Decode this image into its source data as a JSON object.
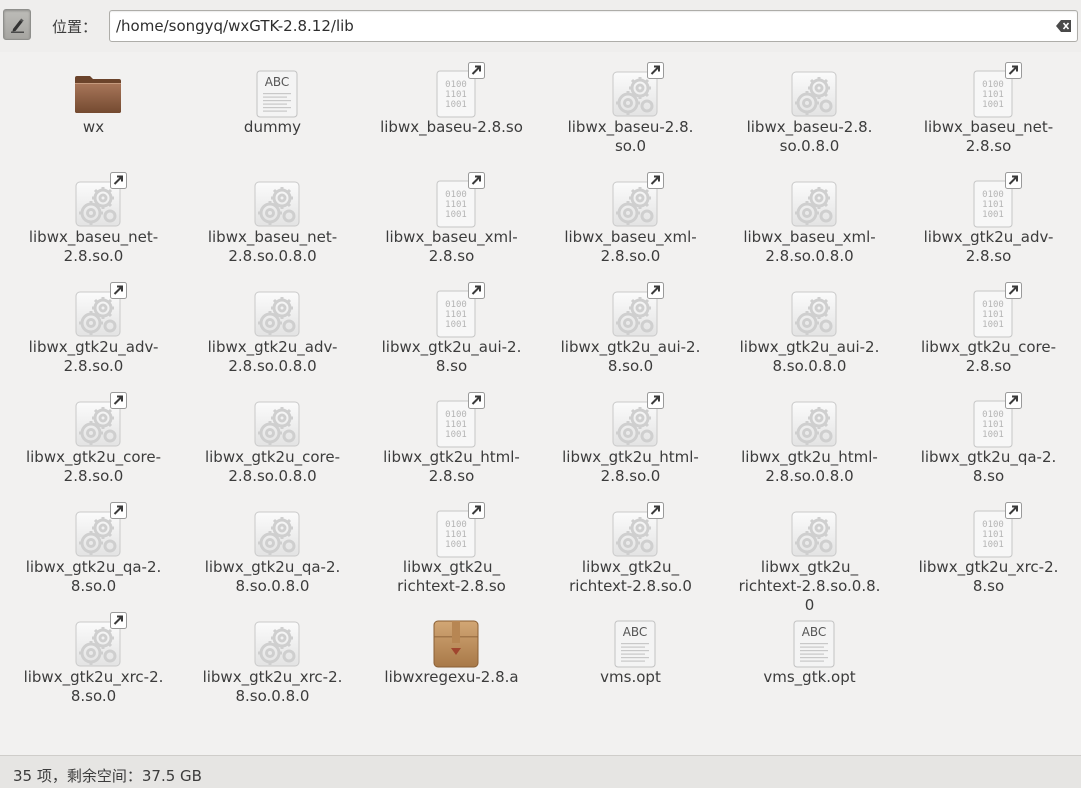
{
  "toolbar": {
    "edit_icon": "pencil-icon",
    "location_label": "位置：",
    "path": "/home/songyq/wxGTK-2.8.12/lib",
    "clear_icon": "clear-entry-icon"
  },
  "files": [
    {
      "name": "wx",
      "label": "wx",
      "icon": "folder",
      "link": false
    },
    {
      "name": "dummy",
      "label": "dummy",
      "icon": "text",
      "link": false
    },
    {
      "name": "libwx_baseu-2.8.so",
      "label": "libwx_baseu-2.8.so",
      "icon": "binary",
      "link": true
    },
    {
      "name": "libwx_baseu-2.8.so.0",
      "label": "libwx_baseu-2.8.\nso.0",
      "icon": "gear",
      "link": true
    },
    {
      "name": "libwx_baseu-2.8.so.0.8.0",
      "label": "libwx_baseu-2.8.\nso.0.8.0",
      "icon": "gear",
      "link": false
    },
    {
      "name": "libwx_baseu_net-2.8.so",
      "label": "libwx_baseu_net-\n2.8.so",
      "icon": "binary",
      "link": true
    },
    {
      "name": "libwx_baseu_net-2.8.so.0",
      "label": "libwx_baseu_net-\n2.8.so.0",
      "icon": "gear",
      "link": true
    },
    {
      "name": "libwx_baseu_net-2.8.so.0.8.0",
      "label": "libwx_baseu_net-\n2.8.so.0.8.0",
      "icon": "gear",
      "link": false
    },
    {
      "name": "libwx_baseu_xml-2.8.so",
      "label": "libwx_baseu_xml-\n2.8.so",
      "icon": "binary",
      "link": true
    },
    {
      "name": "libwx_baseu_xml-2.8.so.0",
      "label": "libwx_baseu_xml-\n2.8.so.0",
      "icon": "gear",
      "link": true
    },
    {
      "name": "libwx_baseu_xml-2.8.so.0.8.0",
      "label": "libwx_baseu_xml-\n2.8.so.0.8.0",
      "icon": "gear",
      "link": false
    },
    {
      "name": "libwx_gtk2u_adv-2.8.so",
      "label": "libwx_gtk2u_adv-\n2.8.so",
      "icon": "binary",
      "link": true
    },
    {
      "name": "libwx_gtk2u_adv-2.8.so.0",
      "label": "libwx_gtk2u_adv-\n2.8.so.0",
      "icon": "gear",
      "link": true
    },
    {
      "name": "libwx_gtk2u_adv-2.8.so.0.8.0",
      "label": "libwx_gtk2u_adv-\n2.8.so.0.8.0",
      "icon": "gear",
      "link": false
    },
    {
      "name": "libwx_gtk2u_aui-2.8.so",
      "label": "libwx_gtk2u_aui-2.\n8.so",
      "icon": "binary",
      "link": true
    },
    {
      "name": "libwx_gtk2u_aui-2.8.so.0",
      "label": "libwx_gtk2u_aui-2.\n8.so.0",
      "icon": "gear",
      "link": true
    },
    {
      "name": "libwx_gtk2u_aui-2.8.so.0.8.0",
      "label": "libwx_gtk2u_aui-2.\n8.so.0.8.0",
      "icon": "gear",
      "link": false
    },
    {
      "name": "libwx_gtk2u_core-2.8.so",
      "label": "libwx_gtk2u_core-\n2.8.so",
      "icon": "binary",
      "link": true
    },
    {
      "name": "libwx_gtk2u_core-2.8.so.0",
      "label": "libwx_gtk2u_core-\n2.8.so.0",
      "icon": "gear",
      "link": true
    },
    {
      "name": "libwx_gtk2u_core-2.8.so.0.8.0",
      "label": "libwx_gtk2u_core-\n2.8.so.0.8.0",
      "icon": "gear",
      "link": false
    },
    {
      "name": "libwx_gtk2u_html-2.8.so",
      "label": "libwx_gtk2u_html-\n2.8.so",
      "icon": "binary",
      "link": true
    },
    {
      "name": "libwx_gtk2u_html-2.8.so.0",
      "label": "libwx_gtk2u_html-\n2.8.so.0",
      "icon": "gear",
      "link": true
    },
    {
      "name": "libwx_gtk2u_html-2.8.so.0.8.0",
      "label": "libwx_gtk2u_html-\n2.8.so.0.8.0",
      "icon": "gear",
      "link": false
    },
    {
      "name": "libwx_gtk2u_qa-2.8.so",
      "label": "libwx_gtk2u_qa-2.\n8.so",
      "icon": "binary",
      "link": true
    },
    {
      "name": "libwx_gtk2u_qa-2.8.so.0",
      "label": "libwx_gtk2u_qa-2.\n8.so.0",
      "icon": "gear",
      "link": true
    },
    {
      "name": "libwx_gtk2u_qa-2.8.so.0.8.0",
      "label": "libwx_gtk2u_qa-2.\n8.so.0.8.0",
      "icon": "gear",
      "link": false
    },
    {
      "name": "libwx_gtk2u_richtext-2.8.so",
      "label": "libwx_gtk2u_\nrichtext-2.8.so",
      "icon": "binary",
      "link": true
    },
    {
      "name": "libwx_gtk2u_richtext-2.8.so.0",
      "label": "libwx_gtk2u_\nrichtext-2.8.so.0",
      "icon": "gear",
      "link": true
    },
    {
      "name": "libwx_gtk2u_richtext-2.8.so.0.8.0",
      "label": "libwx_gtk2u_\nrichtext-2.8.so.0.8.\n0",
      "icon": "gear",
      "link": false
    },
    {
      "name": "libwx_gtk2u_xrc-2.8.so",
      "label": "libwx_gtk2u_xrc-2.\n8.so",
      "icon": "binary",
      "link": true
    },
    {
      "name": "libwx_gtk2u_xrc-2.8.so.0",
      "label": "libwx_gtk2u_xrc-2.\n8.so.0",
      "icon": "gear",
      "link": true
    },
    {
      "name": "libwx_gtk2u_xrc-2.8.so.0.8.0",
      "label": "libwx_gtk2u_xrc-2.\n8.so.0.8.0",
      "icon": "gear",
      "link": false
    },
    {
      "name": "libwxregexu-2.8.a",
      "label": "libwxregexu-2.8.a",
      "icon": "archive",
      "link": false
    },
    {
      "name": "vms.opt",
      "label": "vms.opt",
      "icon": "text",
      "link": false
    },
    {
      "name": "vms_gtk.opt",
      "label": "vms_gtk.opt",
      "icon": "text",
      "link": false
    }
  ],
  "text_icon_caption": "ABC",
  "binary_icon_lines": [
    "0100",
    "1101",
    "1001"
  ],
  "status": {
    "text": "35 项，剩余空间：37.5 GB"
  },
  "colors": {
    "folder": "#8a5a3c",
    "archive": "#b98a57",
    "link_badge": "#4a4a4a",
    "background": "#f2f1f0"
  }
}
